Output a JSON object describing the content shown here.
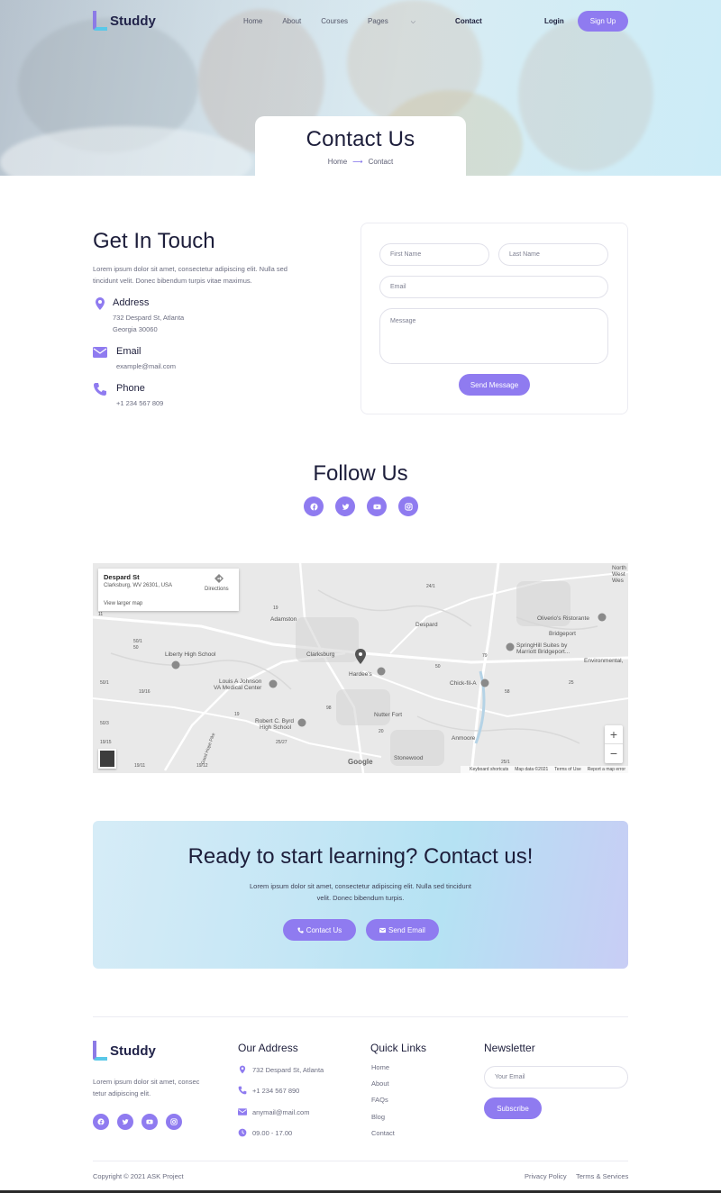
{
  "brand": {
    "name": "Studdy"
  },
  "nav": {
    "items": [
      "Home",
      "About",
      "Courses",
      "Pages",
      "Contact"
    ],
    "active": "Contact",
    "login": "Login",
    "signup": "Sign Up"
  },
  "hero": {
    "title": "Contact Us",
    "breadcrumb": [
      "Home",
      "Contact"
    ]
  },
  "touch": {
    "title": "Get In Touch",
    "description": "Lorem ipsum dolor sit amet, consectetur adipiscing elit. Nulla sed tincidunt velit. Donec bibendum turpis vitae maximus.",
    "address_label": "Address",
    "address_line1": "732 Despard St, Atlanta",
    "address_line2": "Georgia 30060",
    "email_label": "Email",
    "email_value": "example@mail.com",
    "phone_label": "Phone",
    "phone_value": "+1 234 567 809"
  },
  "form": {
    "first_name": "First Name",
    "last_name": "Last Name",
    "email": "Email",
    "message": "Message",
    "submit": "Send Message"
  },
  "follow": {
    "title": "Follow Us",
    "networks": [
      "facebook-icon",
      "twitter-icon",
      "youtube-icon",
      "instagram-icon"
    ]
  },
  "map": {
    "card_title": "Despard St",
    "card_address": "Clarksburg, WV 26301, USA",
    "card_link": "View larger map",
    "card_directions": "Directions",
    "google": "Google",
    "footer": [
      "Keyboard shortcuts",
      "Map data ©2021",
      "Terms of Use",
      "Report a map error"
    ],
    "labels": {
      "north_west": "North",
      "west": "West",
      "wv": "Wes",
      "adamston": "Adamston",
      "despard": "Despard",
      "oliverio": "Oliverio's Ristorante",
      "bridgeport": "Bridgeport",
      "springhill1": "SpringHill Suites by",
      "springhill2": "Marriott Bridgeport...",
      "environmental": "Environmental,",
      "liberty": "Liberty High School",
      "clarksburg": "Clarksburg",
      "hardees": "Hardee's",
      "louis1": "Louis A Johnson",
      "louis2": "VA Medical Center",
      "chickfila": "Chick-fil-A",
      "robert1": "Robert C. Byrd",
      "robert2": "High School",
      "nutter": "Nutter Fort",
      "anmoore": "Anmoore",
      "stonewood": "Stonewood",
      "goodhope": "Good Hope Pike",
      "r1": "24/1",
      "r2": "11",
      "r3": "19",
      "r4": "50/1",
      "r5": "50",
      "r6": "79",
      "r7": "50/1",
      "r8": "50",
      "r9": "58",
      "r10": "25",
      "r11": "98",
      "r12": "19/16",
      "r13": "50/3",
      "r14": "19/15",
      "r15": "20",
      "r16": "25/27",
      "r17": "19/11",
      "r18": "25/1",
      "r19": "50/9",
      "r20": "58",
      "r21": "20",
      "r22": "50",
      "r23": "50",
      "r24": "19",
      "r25": "19/12"
    }
  },
  "cta": {
    "title": "Ready to start learning? Contact us!",
    "text": "Lorem ipsum dolor sit amet, consectetur adipiscing elit. Nulla sed tincidunt velit. Donec bibendum turpis.",
    "contact_btn": "Contact Us",
    "email_btn": "Send Email"
  },
  "footer": {
    "description": "Lorem ipsum dolor sit amet, consec tetur adipiscing elit.",
    "address_title": "Our Address",
    "address": "732 Despard St, Atlanta",
    "phone": "+1 234 567 890",
    "email": "anymail@mail.com",
    "hours": "09.00 - 17.00",
    "links_title": "Quick Links",
    "links": [
      "Home",
      "About",
      "FAQs",
      "Blog",
      "Contact"
    ],
    "newsletter_title": "Newsletter",
    "newsletter_placeholder": "Your Email",
    "subscribe": "Subscribe",
    "copyright": "Copyright © 2021 ASK Project",
    "privacy": "Privacy Policy",
    "terms": "Terms & Services"
  },
  "colors": {
    "accent": "#8f7bf0",
    "dark": "#1d1e3b",
    "muted": "#6b6d80"
  }
}
